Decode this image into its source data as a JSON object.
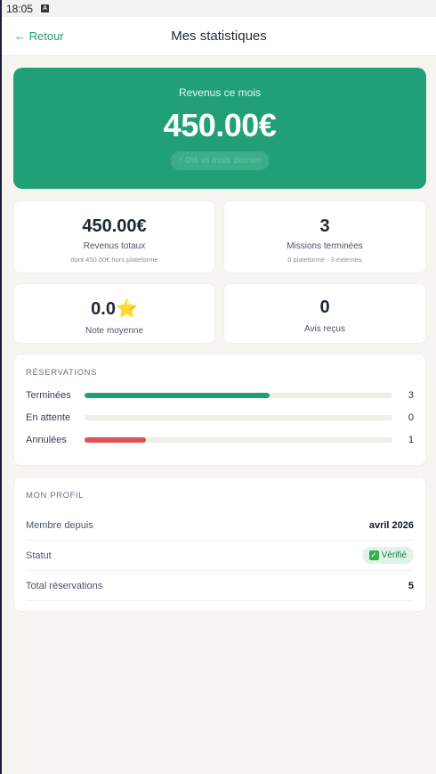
{
  "status_bar": {
    "time": "18:05",
    "notification_icon": "A"
  },
  "header": {
    "back_label": "← Retour",
    "title": "Mes statistiques"
  },
  "hero": {
    "label": "Revenus ce mois",
    "value": "450.00€",
    "trend": "↑ 0% vs mois dernier"
  },
  "stats": [
    {
      "value": "450.00€",
      "label": "Revenus totaux",
      "sub": "dont 450.00€ hors plateforme"
    },
    {
      "value": "3",
      "label": "Missions terminées",
      "sub": "0 plateforme · 3 externes"
    },
    {
      "value": "0.0⭐",
      "label": "Note moyenne"
    },
    {
      "value": "0",
      "label": "Avis reçus"
    }
  ],
  "reservations": {
    "title": "RÉSERVATIONS",
    "rows": [
      {
        "label": "Terminées",
        "count": "3",
        "fraction": 0.6,
        "color": "#21a077"
      },
      {
        "label": "En attente",
        "count": "0",
        "fraction": 0,
        "color": "#21a077"
      },
      {
        "label": "Annulées",
        "count": "1",
        "fraction": 0.2,
        "color": "#e05252"
      }
    ]
  },
  "profile": {
    "title": "MON PROFIL",
    "member_since_label": "Membre depuis",
    "member_since_value": "avril 2026",
    "status_label": "Statut",
    "status_value": "Vérifié",
    "total_label": "Total réservations",
    "total_value": "5"
  },
  "colors": {
    "accent": "#21a077",
    "danger": "#e05252",
    "track": "#f1ede8",
    "background": "#f6f5f2"
  }
}
